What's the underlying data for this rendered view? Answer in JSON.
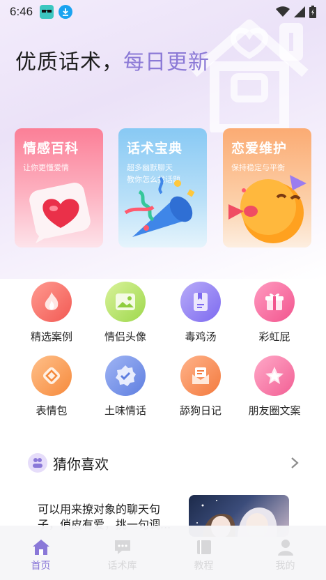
{
  "status_bar": {
    "time": "6:46"
  },
  "header": {
    "title_main": "优质话术，",
    "title_accent": "每日更新"
  },
  "cards": [
    {
      "title": "情感百科",
      "subtitle": "让你更懂爱情",
      "subtitle2": ""
    },
    {
      "title": "话术宝典",
      "subtitle": "超多幽默聊天",
      "subtitle2": "教你怎么找话题"
    },
    {
      "title": "恋爱维护",
      "subtitle": "保持稳定与平衡",
      "subtitle2": ""
    }
  ],
  "grid": [
    {
      "label": "精选案例",
      "icon": "flame-icon"
    },
    {
      "label": "情侣头像",
      "icon": "image-icon"
    },
    {
      "label": "毒鸡汤",
      "icon": "book-icon"
    },
    {
      "label": "彩虹屁",
      "icon": "gift-icon"
    },
    {
      "label": "表情包",
      "icon": "diamond-icon"
    },
    {
      "label": "土味情话",
      "icon": "badge-check-icon"
    },
    {
      "label": "舔狗日记",
      "icon": "letter-icon"
    },
    {
      "label": "朋友圈文案",
      "icon": "star-icon"
    }
  ],
  "section": {
    "title": "猜你喜欢"
  },
  "recommend": {
    "text": "可以用来撩对象的聊天句子，俏皮有爱，挑一句调..."
  },
  "tabs": [
    {
      "label": "首页",
      "active": true
    },
    {
      "label": "话术库",
      "active": false
    },
    {
      "label": "教程",
      "active": false
    },
    {
      "label": "我的",
      "active": false
    }
  ],
  "colors": {
    "accent": "#8b79d6",
    "card1": "#fb7f97",
    "card2": "#87c8f4",
    "card3": "#fbab73"
  }
}
